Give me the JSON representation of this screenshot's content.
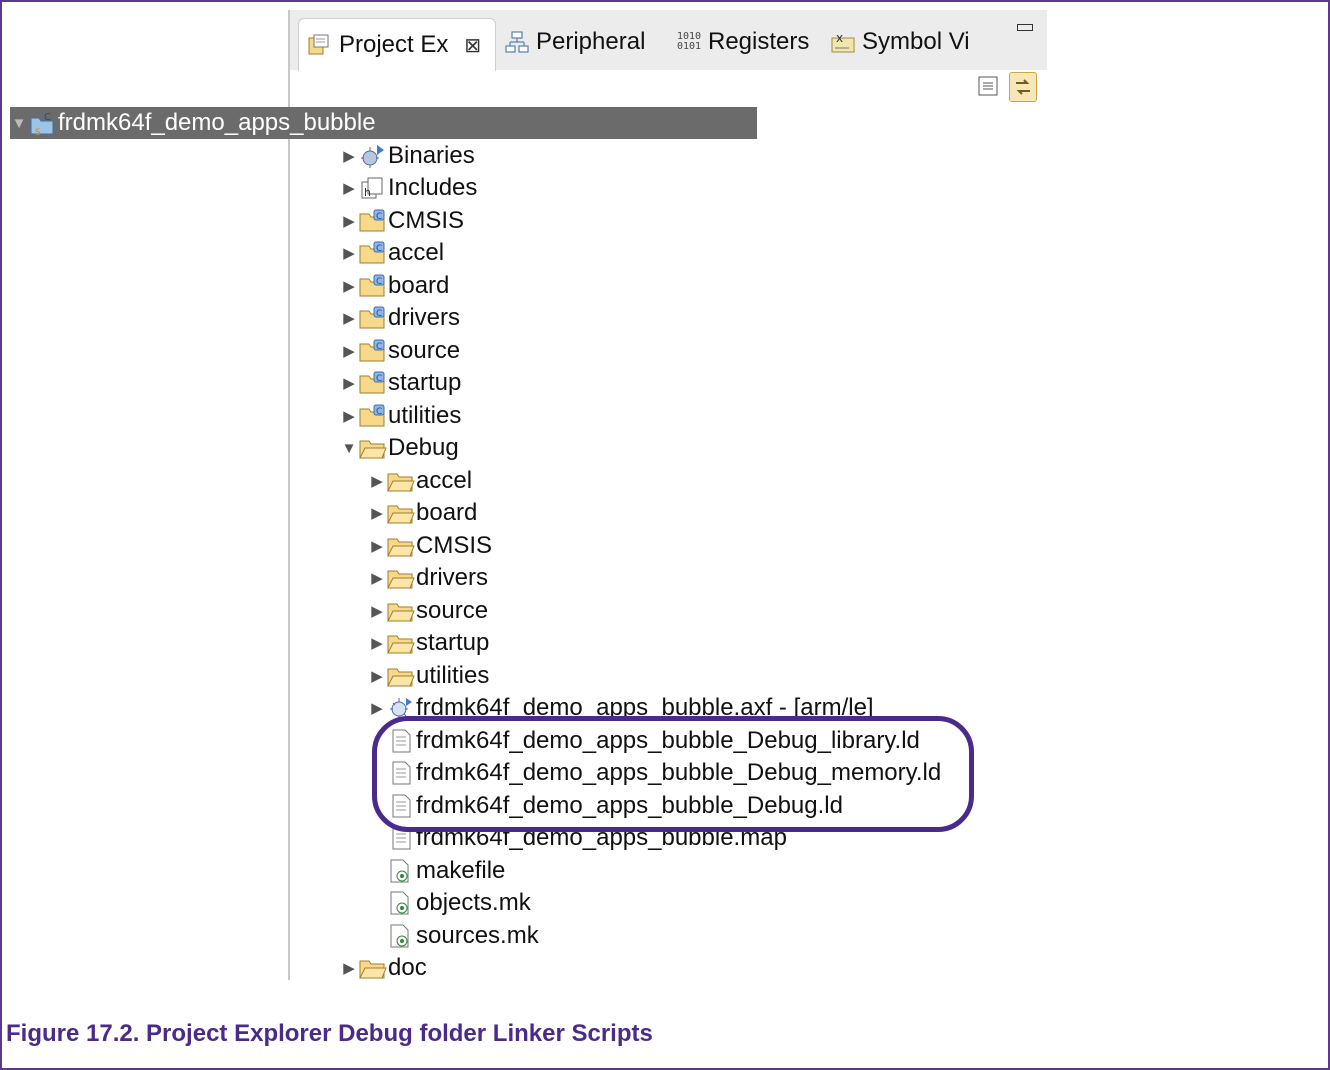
{
  "tabs": [
    {
      "label": "Project Ex",
      "icon": "project-explorer-icon",
      "active": true
    },
    {
      "label": "Peripheral",
      "icon": "peripheral-icon",
      "active": false
    },
    {
      "label": "Registers",
      "icon": "registers-icon",
      "active": false
    },
    {
      "label": "Symbol Vi",
      "icon": "symbol-viewer-icon",
      "active": false
    }
  ],
  "tree": {
    "root": "frdmk64f_demo_apps_bubble",
    "project_items": [
      "Binaries",
      "Includes",
      "CMSIS",
      "accel",
      "board",
      "drivers",
      "source",
      "startup",
      "utilities"
    ],
    "debug_folder": "Debug",
    "debug_items": [
      "accel",
      "board",
      "CMSIS",
      "drivers",
      "source",
      "startup",
      "utilities"
    ],
    "axf": "frdmk64f_demo_apps_bubble.axf - [arm/le]",
    "linker_scripts": [
      "frdmk64f_demo_apps_bubble_Debug_library.ld",
      "frdmk64f_demo_apps_bubble_Debug_memory.ld",
      "frdmk64f_demo_apps_bubble_Debug.ld"
    ],
    "map_file": "frdmk64f_demo_apps_bubble.map",
    "make_files": [
      "makefile",
      "objects.mk",
      "sources.mk"
    ],
    "doc": "doc"
  },
  "caption": "Figure 17.2. Project Explorer Debug folder Linker Scripts",
  "colors": {
    "accent": "#4a2a8a",
    "selection": "#6b6b6b"
  }
}
